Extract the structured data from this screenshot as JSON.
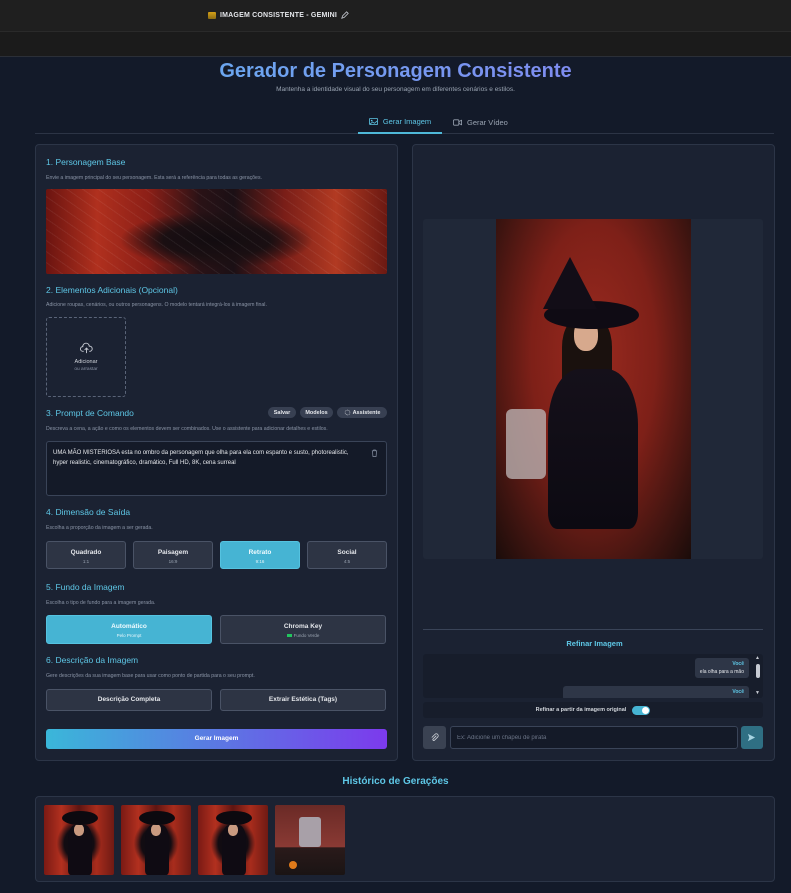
{
  "window": {
    "title": "IMAGEM CONSISTENTE - GEMINI"
  },
  "header": {
    "title": "Gerador de Personagem Consistente",
    "subtitle": "Mantenha a identidade visual do seu personagem em diferentes cenários e estilos."
  },
  "tabs": [
    {
      "label": "Gerar Imagem",
      "active": true
    },
    {
      "label": "Gerar Vídeo",
      "active": false
    }
  ],
  "sections": {
    "base": {
      "title": "1. Personagem Base",
      "desc": "Envie a imagem principal do seu personagem. Esta será a referência para todas as gerações."
    },
    "elements": {
      "title": "2. Elementos Adicionais (Opcional)",
      "desc": "Adicione roupas, cenários, ou outros personagens. O modelo tentará integrá-los à imagem final.",
      "upload_label": "Adicionar",
      "upload_sub": "ou arrastar"
    },
    "prompt": {
      "title": "3. Prompt de Comando",
      "desc": "Descreva a cena, a ação e como os elementos devem ser combinados. Use o assistente para adicionar detalhes e estilos.",
      "buttons": {
        "save": "Salvar",
        "models": "Modelos",
        "assistant": "Assistente"
      },
      "value": "UMA MÃO MISTERIOSA esta no ombro da personagem que olha para ela com espanto e susto, photorealistic, hyper realistic, cinematográfico, dramático, Full HD, 8K, cena surreal"
    },
    "dimension": {
      "title": "4. Dimensão de Saída",
      "desc": "Escolha a proporção da imagem a ser gerada.",
      "options": [
        {
          "label": "Quadrado",
          "ratio": "1:1",
          "selected": false
        },
        {
          "label": "Paisagem",
          "ratio": "16:9",
          "selected": false
        },
        {
          "label": "Retrato",
          "ratio": "9:16",
          "selected": true
        },
        {
          "label": "Social",
          "ratio": "4:5",
          "selected": false
        }
      ]
    },
    "background": {
      "title": "5. Fundo da Imagem",
      "desc": "Escolha o tipo de fundo para a imagem gerada.",
      "options": [
        {
          "label": "Automático",
          "sub": "Pelo Prompt",
          "selected": true
        },
        {
          "label": "Chroma Key",
          "sub": "Fundo Verde",
          "selected": false
        }
      ]
    },
    "description": {
      "title": "6. Descrição da Imagem",
      "desc": "Gere descrições da sua imagem base para usar como ponto de partida para o seu prompt.",
      "buttons": {
        "full": "Descrição Completa",
        "tags": "Extrair Estética (Tags)"
      }
    },
    "generate_label": "Gerar Imagem"
  },
  "refine": {
    "title": "Refinar Imagem",
    "messages": [
      {
        "author": "Você",
        "text": "ela olha para a mão"
      },
      {
        "author": "Você",
        "text": ""
      }
    ],
    "toggle_label": "Refinar a partir da imagem original",
    "toggle_on": true,
    "input_placeholder": "Ex: Adicione um chapéu de pirata"
  },
  "history": {
    "title": "Histórico de Gerações",
    "count": 4
  },
  "colors": {
    "accent": "#5ec7e6",
    "selected": "#46b4d3",
    "gradient_start": "#3ab7d9",
    "gradient_end": "#7c3aed"
  }
}
